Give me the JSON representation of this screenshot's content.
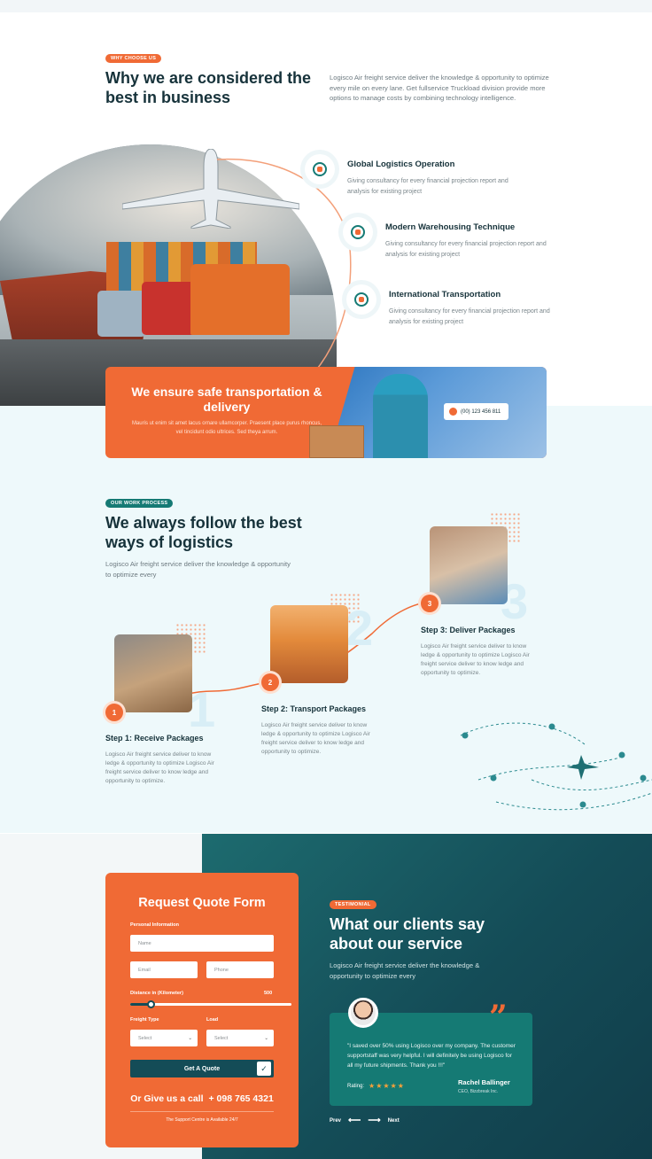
{
  "why": {
    "badge": "WHY CHOOSE US",
    "title": "Why we are considered the best in business",
    "description": "Logisco Air freight service deliver the knowledge & opportunity to optimize every mile on every lane. Get fullservice Truckload division provide more options to manage costs by combining technology intelligence."
  },
  "features": [
    {
      "title": "Global Logistics Operation",
      "text": "Giving consultancy for every financial projection report and analysis for existing project",
      "icon": "globe-icon"
    },
    {
      "title": "Modern Warehousing Technique",
      "text": "Giving consultancy for every financial projection report and analysis for existing project",
      "icon": "warehouse-icon"
    },
    {
      "title": "International Transportation",
      "text": "Giving consultancy for every financial projection report and analysis for existing project",
      "icon": "transport-icon"
    }
  ],
  "promo": {
    "title": "We ensure safe transportation & delivery",
    "text": "Mauris ut enim sit amet lacus ornare ullamcorper. Praesent place purus rhoncus, vel tincidunt odio ultrices. Sed theya arrum.",
    "phone": "(00) 123 456 811"
  },
  "process": {
    "badge": "OUR WORK PROCESS",
    "title": "We always follow the best ways of logistics",
    "description": "Logisco Air freight service deliver the knowledge & opportunity to optimize every",
    "steps": [
      {
        "num": "1",
        "big": "1",
        "title": "Step 1: Receive Packages",
        "text": "Logisco Air freight service deliver to know ledge & opportunity to optimize Logisco Air freight service deliver to know ledge and opportunity to optimize."
      },
      {
        "num": "2",
        "big": "2",
        "title": "Step 2: Transport Packages",
        "text": "Logisco Air freight service deliver to know ledge & opportunity to optimize Logisco Air freight service deliver to know ledge and opportunity to optimize."
      },
      {
        "num": "3",
        "big": "3",
        "title": "Step 3: Deliver Packages",
        "text": "Logisco Air freight service deliver to know ledge & opportunity to optimize Logisco Air freight service deliver to know ledge and opportunity to optimize."
      }
    ]
  },
  "form": {
    "title": "Request Quote Form",
    "personal_label": "Personal Information",
    "name_placeholder": "Name",
    "email_placeholder": "Email",
    "phone_placeholder": "Phone",
    "distance_label": "Distance in (Kilometer)",
    "distance_max": "500",
    "distance_value_fraction": 0.13,
    "freight_label": "Freight Type",
    "load_label": "Load",
    "freight_select": "Select",
    "load_select": "Select",
    "submit_label": "Get A Quote",
    "call_text": "Or Give us a call",
    "call_number": "+ 098 765 4321",
    "support_text": "The Support Centre is Available 24/7"
  },
  "testimonial": {
    "badge": "TESTIMONIAL",
    "title": "What our clients say about our service",
    "description": "Logisco Air freight service deliver the knowledge & opportunity to optimize every",
    "quote": "\"I saved over 50% using Logisco over my company. The customer supportstaff was very helpful. I will definitely be using Logisco for all my future shipments. Thank you !!!\"",
    "rating_label": "Rating:",
    "stars": "★★★★★",
    "rating_value": 5,
    "name": "Rachel Ballinger",
    "role": "CEO, Bizzbreak Inc.",
    "prev_label": "Prev",
    "next_label": "Next"
  },
  "colors": {
    "accent": "#f06a35",
    "teal": "#157a74",
    "dark_teal": "#144c57",
    "band": "#eef9fb"
  }
}
